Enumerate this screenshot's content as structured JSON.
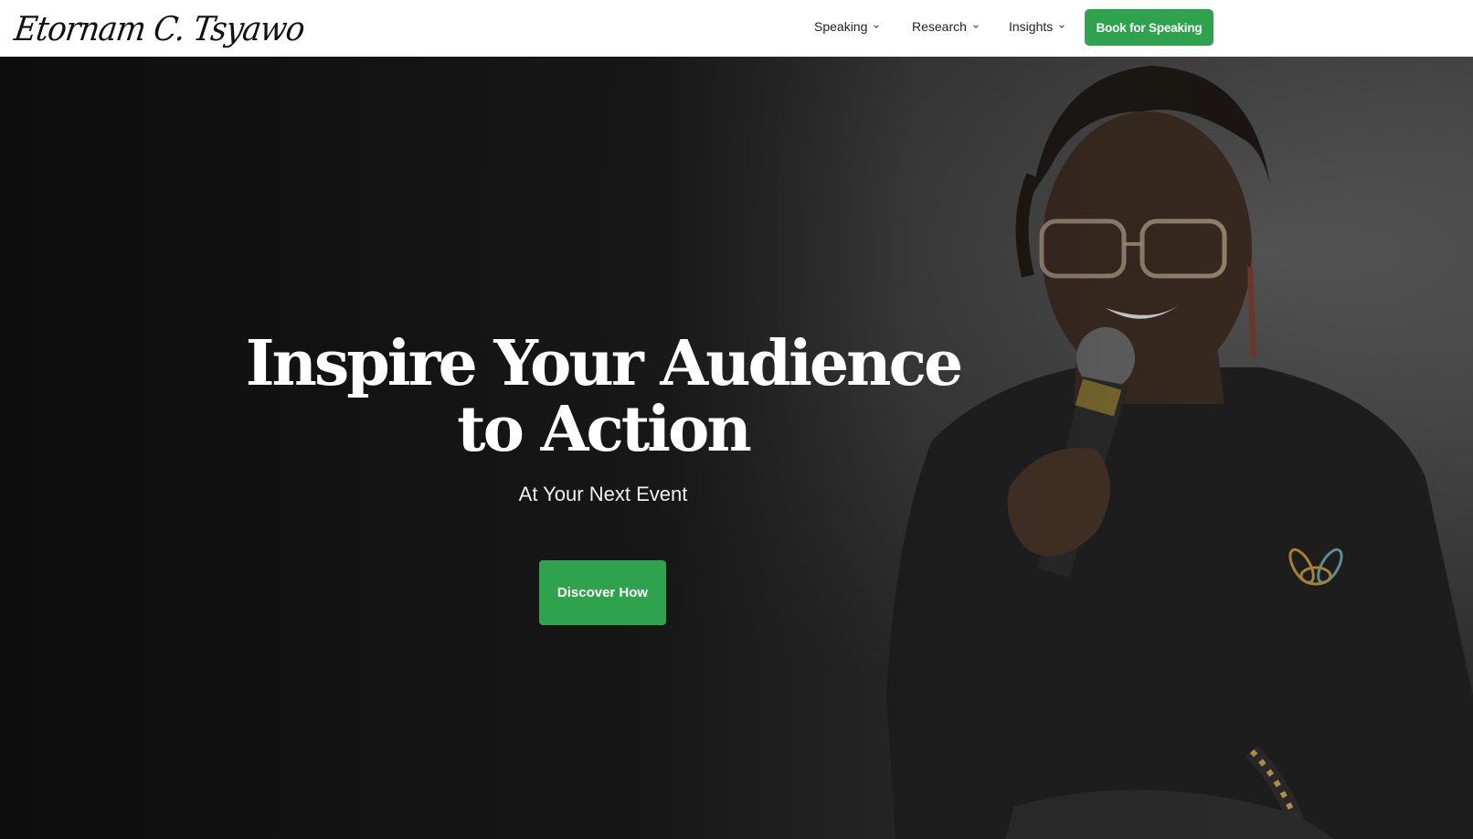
{
  "header": {
    "logo_text": "Etornam C. Tsyawo",
    "nav": [
      {
        "label": "Speaking",
        "icon": "chevron-down-icon"
      },
      {
        "label": "Research",
        "icon": "chevron-down-icon"
      },
      {
        "label": "Insights",
        "icon": "chevron-down-icon"
      }
    ],
    "cta_label": "Book for Speaking"
  },
  "hero": {
    "title": "Inspire Your Audience to Action",
    "subtitle": "At Your Next Event",
    "button_label": "Discover How"
  },
  "colors": {
    "accent": "#2fa24d",
    "header_bg": "#ffffff",
    "hero_overlay": "#111111"
  }
}
